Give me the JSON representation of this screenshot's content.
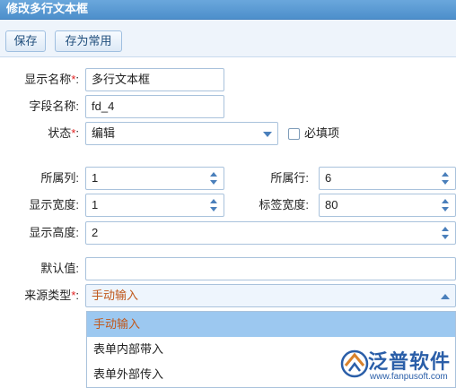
{
  "window": {
    "title": "修改多行文本框"
  },
  "toolbar": {
    "save_label": "保存",
    "save_common_label": "存为常用"
  },
  "form": {
    "display_name": {
      "label": "显示名称",
      "req": "*",
      "colon": ":",
      "value": "多行文本框"
    },
    "field_name": {
      "label": "字段名称:",
      "value": "fd_4"
    },
    "status": {
      "label": "状态",
      "req": "*",
      "colon": ":",
      "value": "编辑"
    },
    "required_checkbox": {
      "label": "必填项",
      "checked": false
    },
    "column": {
      "label": "所属列:",
      "value": "1"
    },
    "row": {
      "label": "所属行:",
      "value": "6"
    },
    "display_width": {
      "label": "显示宽度:",
      "value": "1"
    },
    "label_width": {
      "label": "标签宽度:",
      "value": "80"
    },
    "display_height": {
      "label": "显示高度:",
      "value": "2"
    },
    "default_value": {
      "label": "默认值:",
      "value": ""
    },
    "source_type": {
      "label": "来源类型",
      "req": "*",
      "colon": ":",
      "value": "手动输入",
      "options": [
        "手动输入",
        "表单内部带入",
        "表单外部传入"
      ],
      "selected_index": 0
    }
  },
  "watermark": {
    "brand": "泛普软件",
    "url": "www.fanpusoft.com"
  },
  "colors": {
    "titlebar": "#4d8fcb",
    "selected_option": "#9cc8f0",
    "selected_text": "#c0581b",
    "required_mark": "#e02020"
  }
}
